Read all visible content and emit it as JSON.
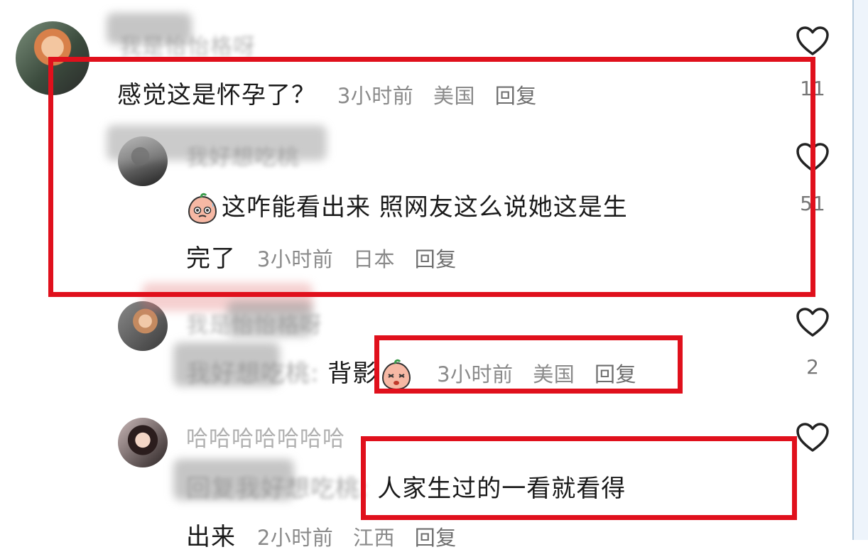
{
  "comments": [
    {
      "username": "我是怡怡格呀",
      "text": "感觉这是怀孕了？",
      "time": "3小时前",
      "location": "美国",
      "reply": "回复",
      "likes": "11"
    },
    {
      "username": "我好想吃桃",
      "text_line1": "这咋能看出来 照网友这么说她这是生",
      "text_line2": "完了",
      "time": "3小时前",
      "location": "日本",
      "reply": "回复",
      "likes": "51"
    },
    {
      "username": "我是怡怡格呀",
      "reply_to": "我好想吃桃:",
      "text": "背影",
      "time": "3小时前",
      "location": "美国",
      "reply": "回复",
      "likes": "2"
    },
    {
      "username": "哈哈哈哈哈哈哈",
      "reply_to": "回复我好想吃桃:",
      "text_line1": "人家生过的一看就看得",
      "text_line2": "出来",
      "time": "2小时前",
      "location": "江西",
      "reply": "回复"
    }
  ],
  "icons": {
    "like": "heart-outline-icon",
    "emoji": "peach-face-emoji"
  },
  "colors": {
    "highlight": "#e0101c",
    "meta_text": "#8a8a8a"
  }
}
